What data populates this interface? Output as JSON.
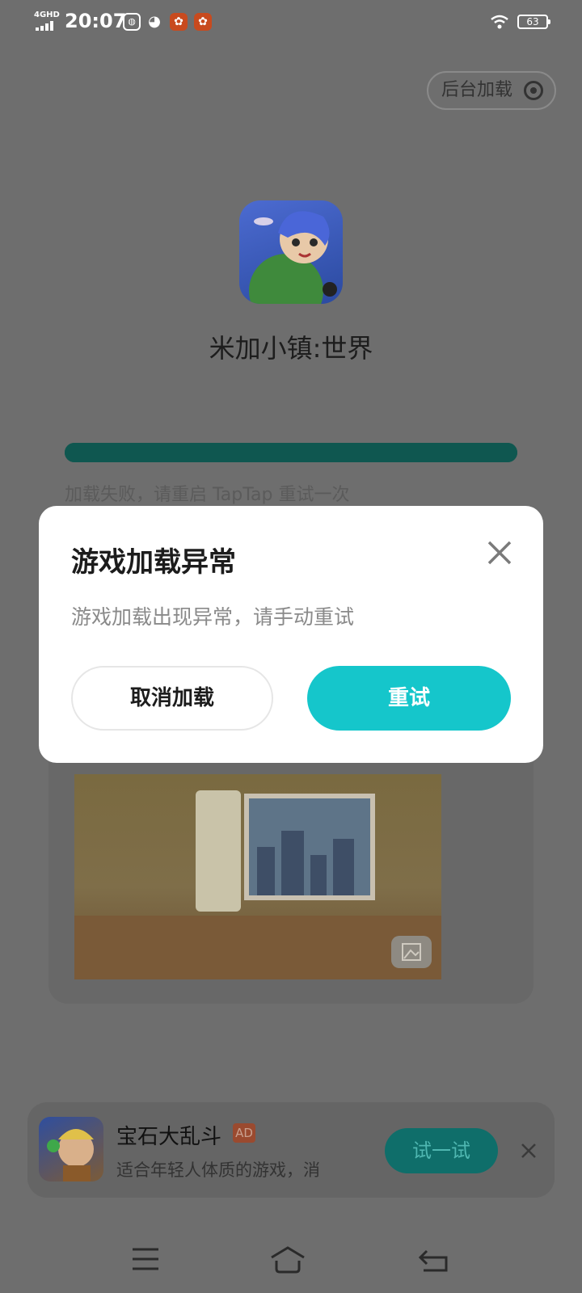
{
  "status_bar": {
    "network": "4GHD",
    "time": "20:07",
    "battery": "63",
    "app_icons": [
      "message-icon",
      "wechat-icon",
      "taptap-icon",
      "taptap-icon"
    ]
  },
  "header": {
    "background_load_label": "后台加载"
  },
  "game": {
    "title": "米加小镇:世界",
    "progress": 1.0,
    "fail_message": "加载失败，请重启 TapTap 重试一次"
  },
  "dialog": {
    "title": "游戏加载异常",
    "message": "游戏加载出现异常，请手动重试",
    "cancel_label": "取消加载",
    "retry_label": "重试"
  },
  "ad": {
    "name": "宝石大乱斗",
    "badge": "AD",
    "description": "适合年轻人体质的游戏，消",
    "try_label": "试一试"
  },
  "nav": {
    "buttons": [
      "menu-icon",
      "home-icon",
      "back-icon"
    ]
  },
  "colors": {
    "accent": "#15c6cb",
    "progress": "#0f5750",
    "overlay": "#6e6e6e"
  }
}
